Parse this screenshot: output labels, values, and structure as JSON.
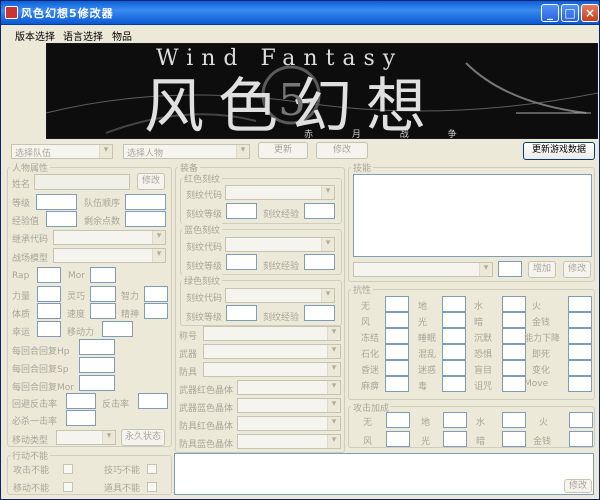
{
  "window": {
    "title": "风色幻想5修改器"
  },
  "menu": {
    "items": [
      "版本选择",
      "语言选择",
      "物品"
    ]
  },
  "banner": {
    "title_en": "Wind Fantasy",
    "title_cn": "风色幻想",
    "subtitle": "赤 月 战 争",
    "numeral": "5"
  },
  "toolbar": {
    "team_select": "选择队伍",
    "char_select": "选择人物",
    "refresh": "更新",
    "modify": "修改",
    "update_game_data": "更新游戏数据"
  },
  "char_attr": {
    "title": "人物属性",
    "name": "姓名",
    "modify": "修改",
    "level": "等级",
    "team_order": "队伍顺序",
    "exp": "经验值",
    "remaining_points": "剩余点数",
    "inherit_code": "继承代码",
    "battle_model": "战场模型",
    "rap": "Rap",
    "mor": "Mor",
    "str": "力量",
    "agi": "灵巧",
    "int": "智力",
    "vit": "体质",
    "spd": "速度",
    "spirit": "精神",
    "luck": "幸运",
    "move": "移动力",
    "hp_regen": "每回合回复Hp",
    "sp_regen": "每回合回复Sp",
    "mor_regen": "每回合回复Mor",
    "evade_counter": "回避反击率",
    "counter": "反击率",
    "crit": "必杀一击率",
    "move_type": "移动类型",
    "permanent": "永久状态"
  },
  "action_disable": {
    "title": "行动不能",
    "attack": "攻击不能",
    "skill": "技巧不能",
    "move": "移动不能",
    "item": "道具不能"
  },
  "equip": {
    "title": "装备",
    "red_crest": "红色刻纹",
    "blue_crest": "蓝色刻纹",
    "green_crest": "绿色刻纹",
    "crest_code": "刻纹代码",
    "crest_level": "刻纹等级",
    "crest_exp": "刻纹经验",
    "title_label": "称号",
    "weapon": "武器",
    "armor": "防具",
    "weapon_red": "武器红色晶体",
    "weapon_blue": "武器蓝色晶体",
    "armor_red": "防具红色晶体",
    "armor_blue": "防具蓝色晶体"
  },
  "skills": {
    "title": "技能",
    "add": "增加",
    "modify": "修改"
  },
  "resist": {
    "title": "抗性",
    "items": [
      "无",
      "地",
      "水",
      "火",
      "风",
      "光",
      "暗",
      "金钱",
      "冻结",
      "睡眠",
      "沉默",
      "能力下降",
      "石化",
      "混乱",
      "恐惧",
      "即死",
      "昏迷",
      "迷惑",
      "盲目",
      "变化",
      "麻痹",
      "毒",
      "诅咒",
      "Move"
    ]
  },
  "attack_bonus": {
    "title": "攻击加成",
    "items": [
      "无",
      "地",
      "水",
      "火",
      "风",
      "光",
      "暗",
      "金钱"
    ]
  },
  "bottom": {
    "modify": "修改"
  }
}
